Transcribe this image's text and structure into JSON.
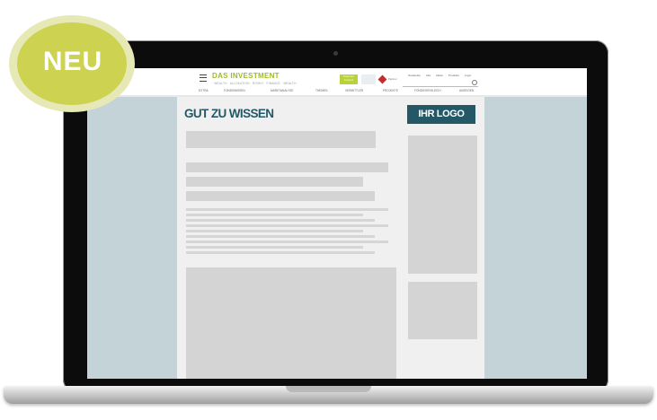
{
  "badge": {
    "label": "NEU"
  },
  "site": {
    "brand": "DAS INVESTMENT",
    "tagline": "· WEALTH · ALLOKATION · RISIKO · FINANCE · WEALTH",
    "promo": "Premium Content",
    "partner": "Partner",
    "top_links": [
      "Newsletter",
      "Abo",
      "Aktien",
      "Produkte",
      "Login"
    ],
    "nav": [
      "EXTRA",
      "FONDSWISSEN",
      "MARKTANALYSE",
      "THEMEN",
      "VERMITTLER",
      "PROJEKTE",
      "FONDSVERGLEICH",
      "ANZEIGEN"
    ]
  },
  "content": {
    "section_title": "GUT ZU WISSEN",
    "logo_placeholder": "IHR LOGO"
  },
  "colors": {
    "badge_fill": "#cdd250",
    "brand_green": "#9dbb2c",
    "brand_teal": "#245866",
    "screen_bg": "#c3d3d7"
  }
}
